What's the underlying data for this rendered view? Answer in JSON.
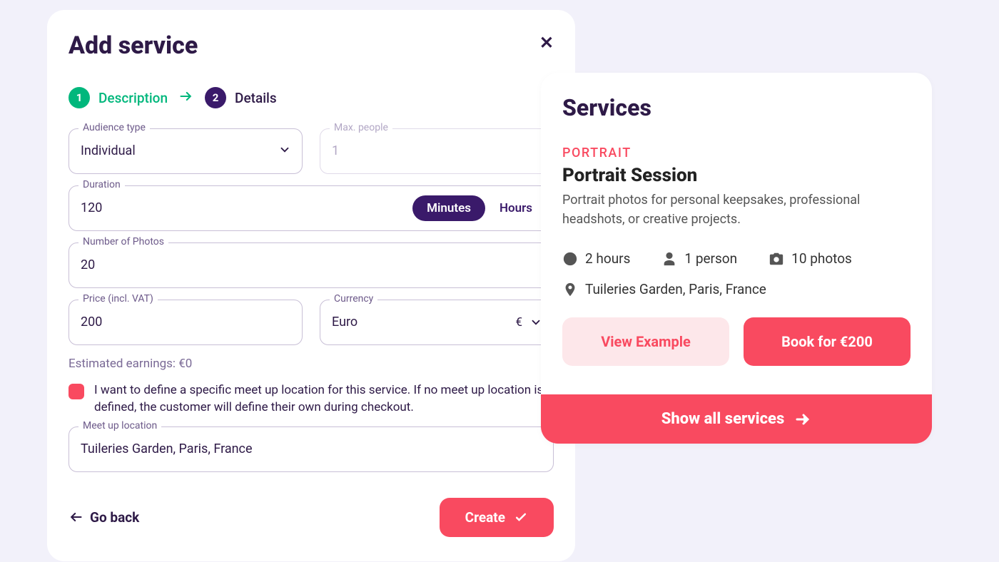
{
  "modal": {
    "title": "Add service",
    "step1": "Description",
    "step2": "Details",
    "step1_num": "1",
    "step2_num": "2",
    "audience_label": "Audience type",
    "audience_value": "Individual",
    "max_people_label": "Max. people",
    "max_people_value": "1",
    "duration_label": "Duration",
    "duration_value": "120",
    "minutes": "Minutes",
    "hours": "Hours",
    "photos_label": "Number of Photos",
    "photos_value": "20",
    "price_label": "Price (incl. VAT)",
    "price_value": "200",
    "currency_label": "Currency",
    "currency_value": "Euro",
    "currency_symbol": "€",
    "estimated": "Estimated earnings: €0",
    "meetup_checkbox": "I want to define a specific meet up location for this service. If no meet up location is defined, the customer will define their own during checkout.",
    "meetup_label": "Meet up location",
    "meetup_value": "Tuileries Garden, Paris, France",
    "go_back": "Go back",
    "create": "Create"
  },
  "preview": {
    "title": "Services",
    "category": "PORTRAIT",
    "name": "Portrait Session",
    "desc": "Portrait photos for personal keepsakes, professional headshots, or creative projects.",
    "duration": "2 hours",
    "people": "1 person",
    "photos": "10 photos",
    "location": "Tuileries Garden, Paris, France",
    "view_example": "View Example",
    "book": "Book for €200",
    "show_all": "Show all services"
  }
}
